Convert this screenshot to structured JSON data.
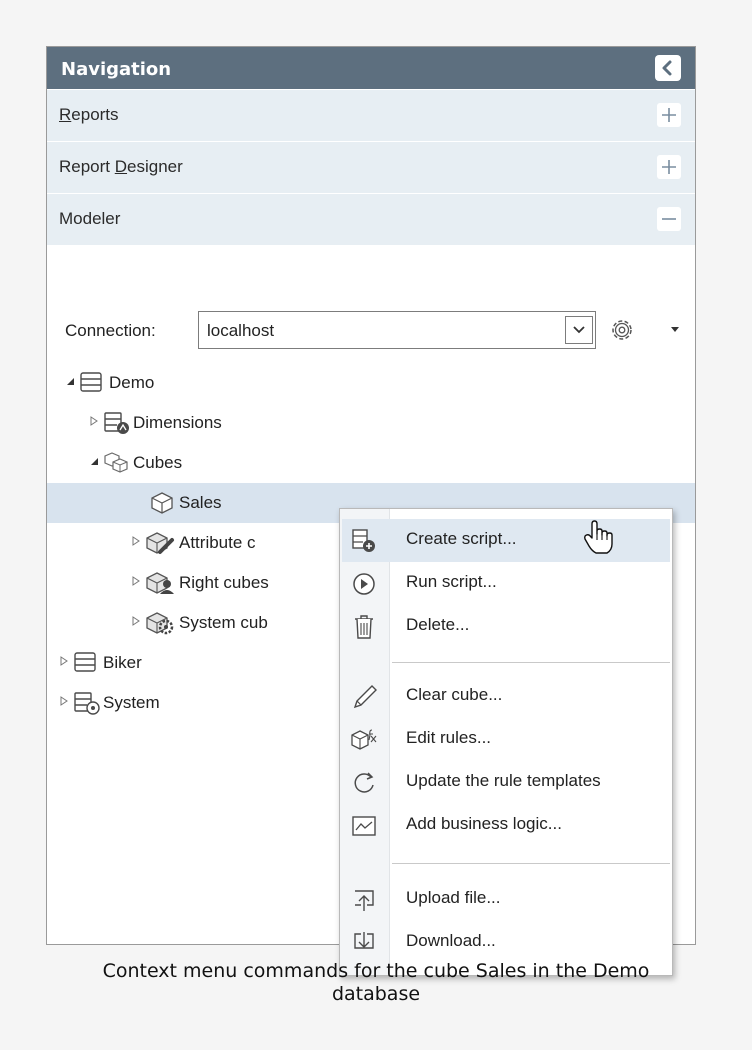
{
  "navigation": {
    "title": "Navigation"
  },
  "sections": {
    "reports": {
      "underline": "R",
      "rest": "eports"
    },
    "report_designer": {
      "before": "Report ",
      "underline": "D",
      "after": "esigner"
    },
    "modeler": {
      "label": "Modeler"
    }
  },
  "connection": {
    "label": "Connection:",
    "value": "localhost"
  },
  "tree": {
    "demo": "Demo",
    "dimensions": "Dimensions",
    "cubes": "Cubes",
    "sales": "Sales",
    "attribute_cubes": "Attribute c",
    "right_cubes": "Right cubes",
    "system_cubes": "System cub",
    "biker": "Biker",
    "system": "System"
  },
  "context_menu": {
    "create_script": "Create script...",
    "run_script": "Run script...",
    "delete": "Delete...",
    "clear_cube": "Clear cube...",
    "edit_rules": "Edit rules...",
    "update_rule_templates": "Update the rule templates",
    "add_business_logic": "Add business logic...",
    "upload_file": "Upload file...",
    "download": "Download..."
  },
  "caption": {
    "line1": "Context menu commands for the cube Sales in the Demo",
    "line2": "database"
  },
  "colors": {
    "header": "#5d6f7f",
    "section": "#e7eef3",
    "selected": "#d8e3ee",
    "menu_hover": "#dfe8f1"
  }
}
